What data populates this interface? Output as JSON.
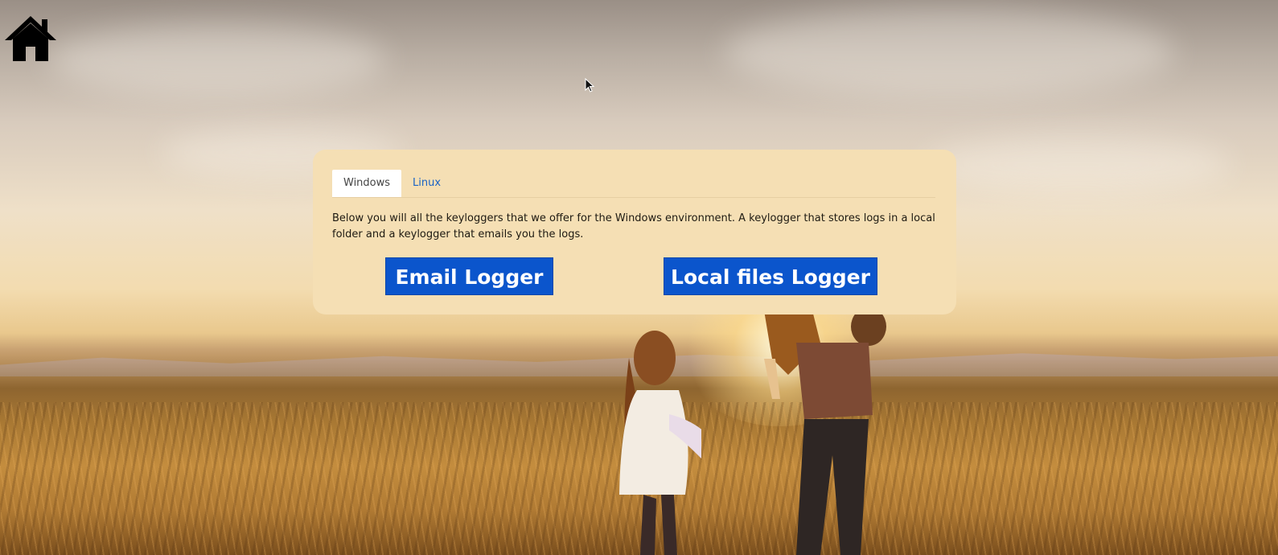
{
  "tabs": [
    {
      "label": "Windows",
      "active": true
    },
    {
      "label": "Linux",
      "active": false
    }
  ],
  "description": "Below you will all the keyloggers that we offer for the Windows environment. A keylogger that stores logs in a local folder and a keylogger that emails you the logs.",
  "buttons": {
    "email_logger": "Email Logger",
    "local_files_logger": "Local files Logger"
  },
  "colors": {
    "panel_background": "#f5dfb4",
    "button_background": "#0b55cc",
    "tab_link": "#1a63c4"
  },
  "icons": {
    "home": "home-icon",
    "cursor": "mouse-cursor-icon"
  }
}
